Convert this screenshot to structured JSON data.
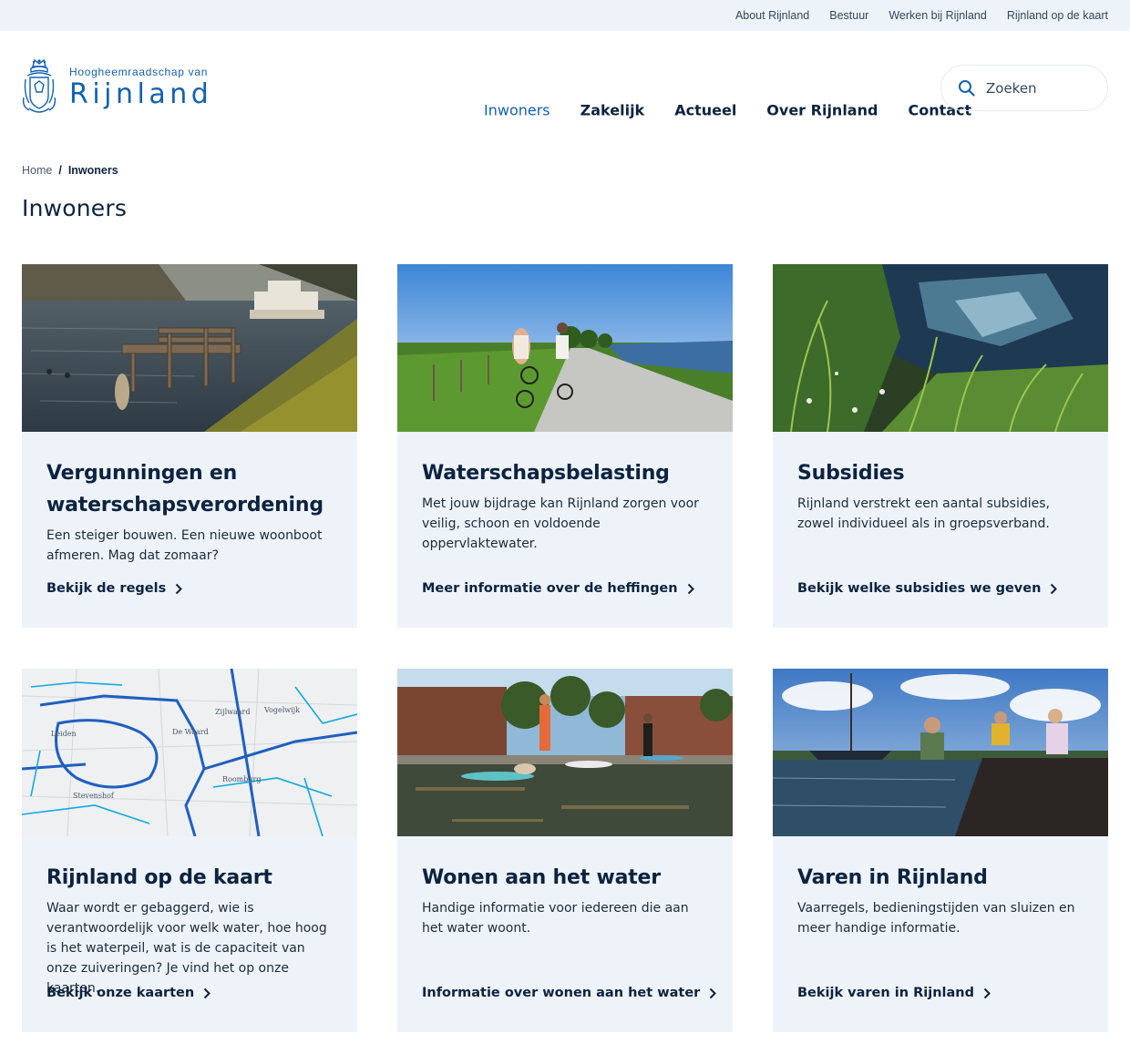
{
  "topbar": {
    "links": [
      "About Rijnland",
      "Bestuur",
      "Werken bij Rijnland",
      "Rijnland op de kaart"
    ]
  },
  "logo": {
    "sub": "Hoogheemraadschap van",
    "main": "Rijnland"
  },
  "nav": {
    "items": [
      "Inwoners",
      "Zakelijk",
      "Actueel",
      "Over Rijnland",
      "Contact"
    ],
    "active": "Inwoners"
  },
  "search": {
    "label": "Zoeken"
  },
  "breadcrumb": {
    "home": "Home",
    "separator": "/",
    "current": "Inwoners"
  },
  "page_title": "Inwoners",
  "colors": {
    "brand_blue": "#1262b3",
    "navy": "#0c2340",
    "card_bg": "#eef3fa"
  },
  "cards": [
    {
      "title": "Vergunningen en waterschapsverordening",
      "text": "Een steiger bouwen. Een nieuwe woonboot af­meren. Mag dat zomaar?",
      "link": "Bekijk de regels",
      "image": "jetty-river-photo"
    },
    {
      "title": "Waterschapsbelasting",
      "text": "Met jouw bijdrage kan Rijnland zorgen voor vei­lig, schoon en voldoende oppervlaktewater.",
      "link": "Meer informatie over de heffingen",
      "image": "cyclists-dike-photo"
    },
    {
      "title": "Subsidies",
      "text": "Rijnland verstrekt een aantal subsidies, zowel individueel als in groepsverband.",
      "link": "Bekijk welke subsidies we geven",
      "image": "reed-pond-photo"
    },
    {
      "title": "Rijnland op de kaart",
      "text": "Waar wordt er gebaggerd, wie is verantwoorde­lijk voor welk water, hoe hoog is het waterpeil, wat is de capaciteit van onze zuiveringen? Je vind het op onze kaarten.",
      "link": "Bekijk onze kaarten",
      "image": "water-map-image",
      "map_labels": [
        "Leiden",
        "De Waard",
        "Zijlwaard",
        "Vogelwijk",
        "Roomburg",
        "Stevenshof"
      ]
    },
    {
      "title": "Wonen aan het water",
      "text": "Handige informatie voor iedereen die aan het water woont.",
      "link": "Informatie over wonen aan het water",
      "image": "supping-canal-photo"
    },
    {
      "title": "Varen in Rijnland",
      "text": "Vaarregels, bedieningstijden van sluizen en meer handige informatie.",
      "link": "Bekijk varen in Rijnland",
      "image": "boating-lake-photo"
    }
  ]
}
